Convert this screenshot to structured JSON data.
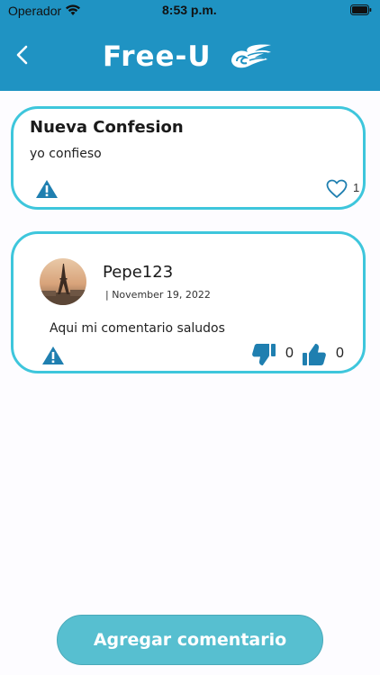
{
  "status_bar": {
    "carrier": "Operador",
    "time": "8:53 p.m."
  },
  "header": {
    "brand": "Free-U",
    "back_icon": "chevron-left-icon",
    "logo_icon": "wing-icon",
    "background_color": "#1f93c3"
  },
  "confession": {
    "title": "Nueva Confesion",
    "body": "yo confieso",
    "like_count": "1",
    "report_icon": "warning-icon",
    "like_icon": "heart-icon"
  },
  "comment": {
    "username": "Pepe123",
    "date": "| November 19, 2022",
    "body": "Aqui mi comentario saludos",
    "dislike_count": "0",
    "like_count": "0",
    "report_icon": "warning-icon",
    "dislike_icon": "thumbs-down-icon",
    "like_icon": "thumbs-up-icon"
  },
  "actions": {
    "add_comment_label": "Agregar comentario"
  },
  "colors": {
    "accent": "#1f93c3",
    "card_border": "#3ec6dc",
    "button": "#57bfd0"
  }
}
